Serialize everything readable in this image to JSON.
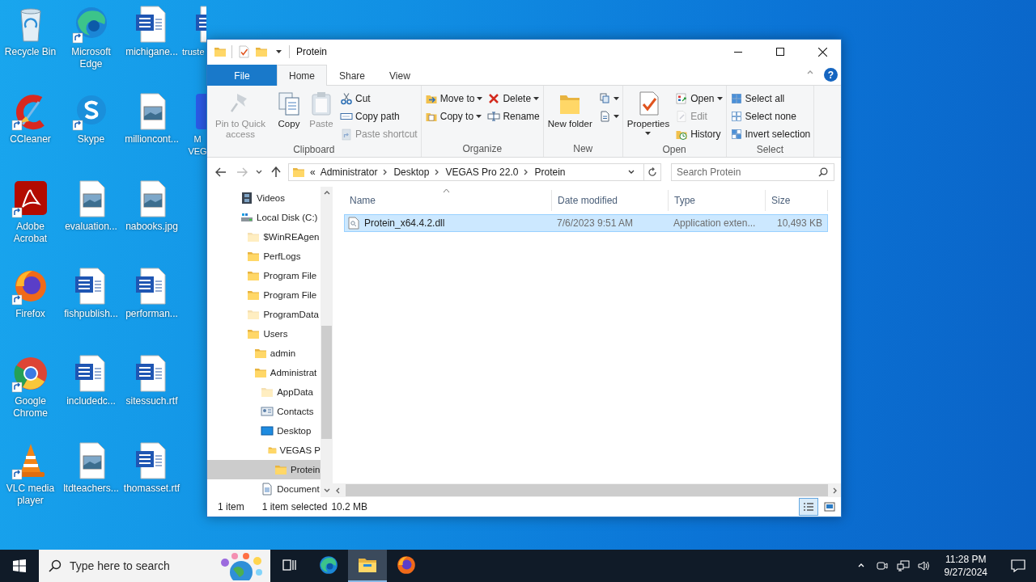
{
  "desktop_icons": [
    {
      "kind": "recycle",
      "label": "Recycle Bin",
      "shortcut": false
    },
    {
      "kind": "ccleaner",
      "label": "CCleaner",
      "shortcut": true
    },
    {
      "kind": "acrobat",
      "label": "Adobe Acrobat",
      "shortcut": true
    },
    {
      "kind": "firefox",
      "label": "Firefox",
      "shortcut": true
    },
    {
      "kind": "chrome",
      "label": "Google Chrome",
      "shortcut": true
    },
    {
      "kind": "vlc",
      "label": "VLC media player",
      "shortcut": true
    },
    {
      "kind": "edge",
      "label": "Microsoft Edge",
      "shortcut": true
    },
    {
      "kind": "skype",
      "label": "Skype",
      "shortcut": true
    },
    {
      "kind": "image",
      "label": "evaluation...",
      "shortcut": false
    },
    {
      "kind": "word",
      "label": "fishpublish...",
      "shortcut": false
    },
    {
      "kind": "word",
      "label": "includedc...",
      "shortcut": false
    },
    {
      "kind": "image",
      "label": "ltdteachers...",
      "shortcut": false
    },
    {
      "kind": "word",
      "label": "michigane...",
      "shortcut": false
    },
    {
      "kind": "image",
      "label": "millioncont...",
      "shortcut": false
    },
    {
      "kind": "image",
      "label": "nabooks.jpg",
      "shortcut": false
    },
    {
      "kind": "word",
      "label": "performan...",
      "shortcut": false
    },
    {
      "kind": "word",
      "label": "sitessuch.rtf",
      "shortcut": false
    },
    {
      "kind": "word",
      "label": "thomasset.rtf",
      "shortcut": false
    },
    {
      "kind": "word",
      "label": "truste",
      "shortcut": false
    },
    {
      "kind": "app",
      "label": "M VEG",
      "shortcut": false
    }
  ],
  "window": {
    "title": "Protein",
    "help": "?"
  },
  "ribbon": {
    "tabs": [
      {
        "kind": "file",
        "label": "File",
        "selected": false
      },
      {
        "kind": "tab",
        "label": "Home",
        "selected": true
      },
      {
        "kind": "tab",
        "label": "Share",
        "selected": false
      },
      {
        "kind": "tab",
        "label": "View",
        "selected": false
      }
    ],
    "groups": [
      {
        "label": "Clipboard",
        "columns": [
          [
            {
              "kind": "pin",
              "label": "Pin to Quick access",
              "large": true,
              "disabled": true,
              "menu": false
            }
          ],
          [
            {
              "kind": "copy",
              "label": "Copy",
              "large": true,
              "disabled": false,
              "menu": false
            }
          ],
          [
            {
              "kind": "paste",
              "label": "Paste",
              "large": true,
              "disabled": true,
              "menu": false
            }
          ],
          [
            {
              "kind": "cut",
              "label": "Cut",
              "large": false,
              "disabled": false,
              "menu": false
            },
            {
              "kind": "copypath",
              "label": "Copy path",
              "large": false,
              "disabled": false,
              "menu": false
            },
            {
              "kind": "pasteshortcut",
              "label": "Paste shortcut",
              "large": false,
              "disabled": true,
              "menu": false
            }
          ]
        ]
      },
      {
        "label": "Organize",
        "columns": [
          [
            {
              "kind": "moveto",
              "label": "Move to",
              "large": false,
              "disabled": false,
              "menu": true
            },
            {
              "kind": "copyto",
              "label": "Copy to",
              "large": false,
              "disabled": false,
              "menu": true
            }
          ],
          [
            {
              "kind": "delete",
              "label": "Delete",
              "large": false,
              "disabled": false,
              "menu": true
            },
            {
              "kind": "rename",
              "label": "Rename",
              "large": false,
              "disabled": false,
              "menu": false
            }
          ]
        ]
      },
      {
        "label": "New",
        "columns": [
          [
            {
              "kind": "newfolder",
              "label": "New folder",
              "large": true,
              "disabled": false,
              "menu": false
            }
          ],
          [
            {
              "kind": "newitem",
              "large": false,
              "disabled": false,
              "menu": true
            },
            {
              "kind": "easyaccess",
              "large": false,
              "disabled": false,
              "menu": true
            }
          ]
        ]
      },
      {
        "label": "Open",
        "columns": [
          [
            {
              "kind": "properties",
              "label": "Properties",
              "large": true,
              "disabled": false,
              "menu": true
            }
          ],
          [
            {
              "kind": "open",
              "label": "Open",
              "large": false,
              "disabled": false,
              "menu": true
            },
            {
              "kind": "edit",
              "label": "Edit",
              "large": false,
              "disabled": true,
              "menu": false
            },
            {
              "kind": "history",
              "label": "History",
              "large": false,
              "disabled": false,
              "menu": false
            }
          ]
        ]
      },
      {
        "label": "Select",
        "columns": [
          [
            {
              "kind": "selectall",
              "label": "Select all",
              "large": false,
              "disabled": false,
              "menu": false
            },
            {
              "kind": "selectnone",
              "label": "Select none",
              "large": false,
              "disabled": false,
              "menu": false
            },
            {
              "kind": "invert",
              "label": "Invert selection",
              "large": false,
              "disabled": false,
              "menu": false
            }
          ]
        ]
      }
    ]
  },
  "address": {
    "back": {
      "disabled": false
    },
    "forward": {
      "disabled": true
    },
    "overflow": "«",
    "crumbs": [
      "Administrator",
      "Desktop",
      "VEGAS Pro 22.0",
      "Protein"
    ],
    "search_placeholder": "Search Protein"
  },
  "nav_tree": [
    {
      "kind": "videos",
      "label": "Videos",
      "selected": false,
      "hidden": false
    },
    {
      "kind": "drive",
      "label": "Local Disk (C:)",
      "selected": false,
      "hidden": false,
      "children": [
        {
          "kind": "folder",
          "label": "$WinREAgen",
          "selected": false,
          "hidden": true
        },
        {
          "kind": "folder",
          "label": "PerfLogs",
          "selected": false,
          "hidden": false
        },
        {
          "kind": "folder",
          "label": "Program File",
          "selected": false,
          "hidden": false
        },
        {
          "kind": "folder",
          "label": "Program File",
          "selected": false,
          "hidden": false
        },
        {
          "kind": "folder",
          "label": "ProgramData",
          "selected": false,
          "hidden": true
        },
        {
          "kind": "folder",
          "label": "Users",
          "selected": false,
          "hidden": false,
          "children": [
            {
              "kind": "folder",
              "label": "admin",
              "selected": false,
              "hidden": false
            },
            {
              "kind": "folder",
              "label": "Administrat",
              "selected": false,
              "hidden": false,
              "children": [
                {
                  "kind": "folder",
                  "label": "AppData",
                  "selected": false,
                  "hidden": true
                },
                {
                  "kind": "contacts",
                  "label": "Contacts",
                  "selected": false,
                  "hidden": false
                },
                {
                  "kind": "desktop",
                  "label": "Desktop",
                  "selected": false,
                  "hidden": false,
                  "children": [
                    {
                      "kind": "folder",
                      "label": "VEGAS P",
                      "selected": false,
                      "hidden": false,
                      "children": [
                        {
                          "kind": "folder",
                          "label": "Protein",
                          "selected": true,
                          "hidden": false
                        }
                      ]
                    }
                  ]
                },
                {
                  "kind": "documents",
                  "label": "Document",
                  "selected": false,
                  "hidden": false
                }
              ]
            }
          ]
        }
      ]
    }
  ],
  "table": {
    "columns": [
      "Name",
      "Date modified",
      "Type",
      "Size"
    ],
    "rows": [
      {
        "name": "Protein_x64.4.2.dll",
        "date": "7/6/2023 9:51 AM",
        "type": "Application exten...",
        "size": "10,493 KB",
        "selected": true
      }
    ]
  },
  "status_bar": {
    "count": "1 item",
    "selection": "1 item selected",
    "size": "10.2 MB",
    "views": [
      {
        "kind": "details",
        "selected": true
      },
      {
        "kind": "thumbnails",
        "selected": false
      }
    ]
  },
  "taskbar": {
    "search_placeholder": "Type here to search",
    "apps": [
      {
        "kind": "taskview",
        "selected": false
      },
      {
        "kind": "edge",
        "selected": false
      },
      {
        "kind": "explorer",
        "selected": true
      },
      {
        "kind": "firefox",
        "selected": false
      }
    ],
    "time": "11:28 PM",
    "date": "9/27/2024"
  }
}
